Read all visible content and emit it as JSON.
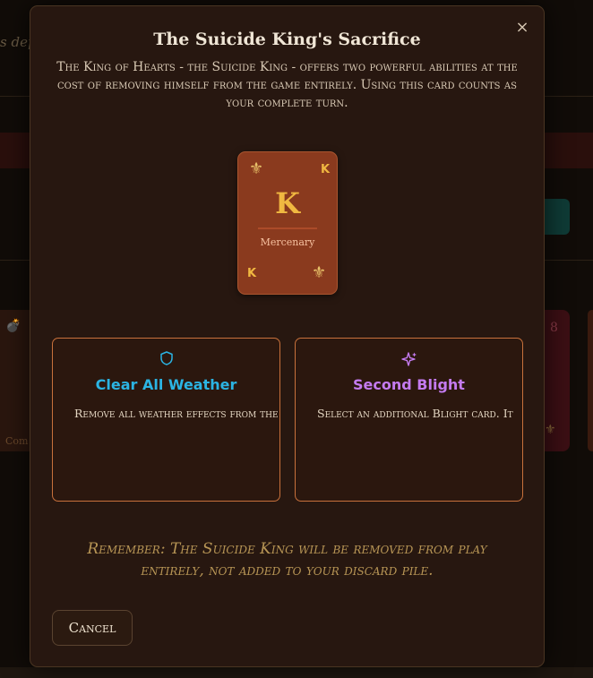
{
  "background": {
    "header_fragment": "s dep",
    "teal_button_fragment": "n",
    "bomb_glyph": "💣",
    "left_card_fragment": "Com",
    "right_card_number": "8",
    "right_card_fleur": "⚜"
  },
  "modal": {
    "title": "The Suicide King's Sacrifice",
    "description": "The King of Hearts - the Suicide King - offers two powerful abilities at the cost of removing himself from the game entirely. Using this card counts as your complete turn.",
    "close_symbol": "×"
  },
  "card": {
    "rank": "K",
    "type_label": "Mercenary",
    "suit_symbol": "⚜"
  },
  "options": [
    {
      "title": "Clear All Weather",
      "description": "Remove all weather effects from the battlefield",
      "icon": "shield-icon",
      "color": "#2bb4e3"
    },
    {
      "title": "Second Blight",
      "description": "Select an additional Blight card. It",
      "icon": "sparkles-icon",
      "color": "#c47bf0"
    }
  ],
  "reminder": "Remember: The Suicide King will be removed from play entirely, not added to your discard pile.",
  "cancel_label": "Cancel",
  "colors": {
    "modal_bg": "#271710",
    "card_bg": "#8a3a1e",
    "option_border": "#c8713c",
    "reminder_text": "#b79555"
  }
}
